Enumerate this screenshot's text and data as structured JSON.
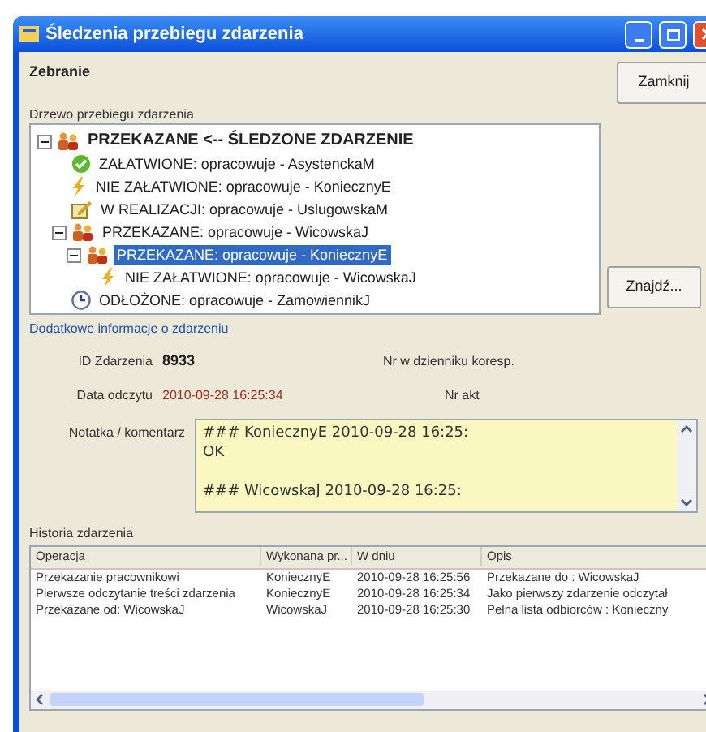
{
  "window": {
    "title": "Śledzenia przebiegu zdarzenia"
  },
  "header": "Zebranie",
  "buttons": {
    "close": "Zamknij",
    "find": "Znajdź..."
  },
  "tree": {
    "label": "Drzewo przebiegu zdarzenia",
    "root": {
      "label": "PRZEKAZANE <-- ŚLEDZONE ZDARZENIE",
      "kind": "forwarded",
      "expanded": true,
      "selected": false,
      "children": [
        {
          "label": "ZAŁATWIONE: opracowuje - AsystenckaM",
          "kind": "done",
          "selected": false
        },
        {
          "label": "NIE ZAŁATWIONE: opracowuje - KoniecznyE",
          "kind": "failed",
          "selected": false
        },
        {
          "label": "W REALIZACJI: opracowuje - UslugowskaM",
          "kind": "in_progress",
          "selected": false
        },
        {
          "label": "PRZEKAZANE: opracowuje - WicowskaJ",
          "kind": "forwarded",
          "expanded": true,
          "selected": false,
          "children": [
            {
              "label": "PRZEKAZANE: opracowuje - KoniecznyE",
              "kind": "forwarded",
              "expanded": true,
              "selected": true,
              "children": [
                {
                  "label": "NIE ZAŁATWIONE: opracowuje - WicowskaJ",
                  "kind": "failed",
                  "selected": false
                }
              ]
            }
          ]
        },
        {
          "label": "ODŁOŻONE: opracowuje - ZamowiennikJ",
          "kind": "postponed",
          "selected": false
        }
      ]
    }
  },
  "details": {
    "title": "Dodatkowe informacje o zdarzeniu",
    "id_label": "ID Zdarzenia",
    "id_value": "8933",
    "journal_label": "Nr w dzienniku koresp.",
    "read_label": "Data odczytu",
    "read_value": "2010-09-28 16:25:34",
    "file_label": "Nr akt",
    "note_label": "Notatka / komentarz",
    "note_value": "### KoniecznyE 2010-09-28 16:25:\nOK\n\n### WicowskaJ 2010-09-28 16:25:"
  },
  "history": {
    "title": "Historia zdarzenia",
    "columns": [
      "Operacja",
      "Wykonana pr...",
      "W dniu",
      "Opis"
    ],
    "rows": [
      [
        "Przekazanie pracownikowi",
        "KoniecznyE",
        "2010-09-28 16:25:56",
        "Przekazane do : WicowskaJ"
      ],
      [
        "Pierwsze odczytanie treści zdarzenia",
        "KoniecznyE",
        "2010-09-28 16:25:34",
        "Jako pierwszy zdarzenie odczytał"
      ],
      [
        "Przekazane  od: WicowskaJ",
        "WicowskaJ",
        "2010-09-28 16:25:30",
        "Pełna lista odbiorców : Konieczny"
      ]
    ]
  }
}
